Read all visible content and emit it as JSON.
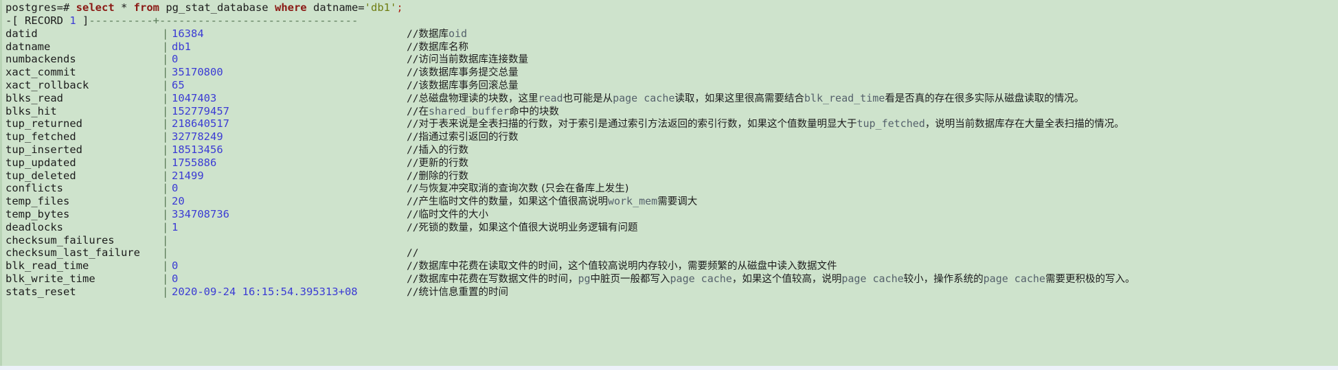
{
  "terminal": {
    "background_color": "#cee3cc",
    "prompt": "postgres=#",
    "query": {
      "kw_select": "select",
      "star": " * ",
      "kw_from": "from",
      "table": " pg_stat_database ",
      "kw_where": "where",
      "predicate": " datname=",
      "string_literal": "'db1'",
      "semicolon": ";"
    },
    "record_header": {
      "prefix": "-[ RECORD ",
      "number": "1",
      "suffix": " ]",
      "dashes_left": "----------",
      "plus": "+",
      "dashes_right": "-------------------------------"
    },
    "rows": [
      {
        "name": "datid",
        "value": "16384",
        "comment_prefix": "//",
        "comment": "数据库",
        "comment_code": "oid",
        "comment_tail": ""
      },
      {
        "name": "datname",
        "value": "db1",
        "comment_prefix": "//",
        "comment": "数据库名称",
        "comment_code": "",
        "comment_tail": ""
      },
      {
        "name": "numbackends",
        "value": "0",
        "comment_prefix": "//",
        "comment": "访问当前数据库连接数量",
        "comment_code": "",
        "comment_tail": ""
      },
      {
        "name": "xact_commit",
        "value": "35170800",
        "comment_prefix": "//",
        "comment": "该数据库事务提交总量",
        "comment_code": "",
        "comment_tail": ""
      },
      {
        "name": "xact_rollback",
        "value": "65",
        "comment_prefix": "//",
        "comment": "该数据库事务回滚总量",
        "comment_code": "",
        "comment_tail": ""
      },
      {
        "name": "blks_read",
        "value": "1047403",
        "comment_prefix": "//",
        "comment": "总磁盘物理读的块数，这里",
        "comment_code": "read",
        "comment_tail": "也可能是从",
        "comment_code2": "page cache",
        "comment_tail2": "读取，如果这里很高需要结合",
        "comment_code3": "blk_read_time",
        "comment_tail3": "看是否真的存在很多实际从磁盘读取的情况。"
      },
      {
        "name": "blks_hit",
        "value": "152779457",
        "comment_prefix": "//",
        "comment": "在",
        "comment_code": "shared_buffer",
        "comment_tail": "命中的块数"
      },
      {
        "name": "tup_returned",
        "value": "218640517",
        "comment_prefix": "//",
        "comment": "对于表来说是全表扫描的行数，对于索引是通过索引方法返回的索引行数，如果这个值数量明显大于",
        "comment_code": "tup_fetched",
        "comment_tail": "，说明当前数据库存在大量全表扫描的情况。"
      },
      {
        "name": "tup_fetched",
        "value": "32778249",
        "comment_prefix": "//",
        "comment": "指通过索引返回的行数",
        "comment_code": "",
        "comment_tail": ""
      },
      {
        "name": "tup_inserted",
        "value": "18513456",
        "comment_prefix": "//",
        "comment": "插入的行数",
        "comment_code": "",
        "comment_tail": ""
      },
      {
        "name": "tup_updated",
        "value": "1755886",
        "comment_prefix": "//",
        "comment": "更新的行数",
        "comment_code": "",
        "comment_tail": ""
      },
      {
        "name": "tup_deleted",
        "value": "21499",
        "comment_prefix": "//",
        "comment": "删除的行数",
        "comment_code": "",
        "comment_tail": ""
      },
      {
        "name": "conflicts",
        "value": "0",
        "comment_prefix": "//",
        "comment": "与恢复冲突取消的查询次数 (只会在备库上发生)",
        "comment_code": "",
        "comment_tail": ""
      },
      {
        "name": "temp_files",
        "value": "20",
        "comment_prefix": "//",
        "comment": "产生临时文件的数量，如果这个值很高说明",
        "comment_code": "work_mem",
        "comment_tail": "需要调大"
      },
      {
        "name": "temp_bytes",
        "value": "334708736",
        "comment_prefix": "//",
        "comment": "临时文件的大小",
        "comment_code": "",
        "comment_tail": ""
      },
      {
        "name": "deadlocks",
        "value": "1",
        "comment_prefix": "//",
        "comment": "死锁的数量，如果这个值很大说明业务逻辑有问题",
        "comment_code": "",
        "comment_tail": ""
      },
      {
        "name": "checksum_failures",
        "value": "",
        "comment_prefix": "",
        "comment": "",
        "comment_code": "",
        "comment_tail": ""
      },
      {
        "name": "checksum_last_failure",
        "value": "",
        "comment_prefix": "//",
        "comment": "",
        "comment_code": "",
        "comment_tail": ""
      },
      {
        "name": "blk_read_time",
        "value": "0",
        "comment_prefix": "//",
        "comment": "数据库中花费在读取文件的时间，这个值较高说明内存较小，需要频繁的从磁盘中读入数据文件",
        "comment_code": "",
        "comment_tail": ""
      },
      {
        "name": "blk_write_time",
        "value": "0",
        "comment_prefix": "//",
        "comment": "数据库中花费在写数据文件的时间，",
        "comment_code": "pg",
        "comment_tail": "中脏页一般都写入",
        "comment_code2": "page cache",
        "comment_tail2": "，如果这个值较高，说明",
        "comment_code3": "page cache",
        "comment_tail3": "较小，操作系统的",
        "comment_code4": "page cache",
        "comment_tail4": "需要更积极的写入。"
      },
      {
        "name": "stats_reset",
        "value": "2020-09-24 16:15:54.395313+08",
        "comment_prefix": "//",
        "comment": "统计信息重置的时间",
        "comment_code": "",
        "comment_tail": ""
      }
    ]
  }
}
